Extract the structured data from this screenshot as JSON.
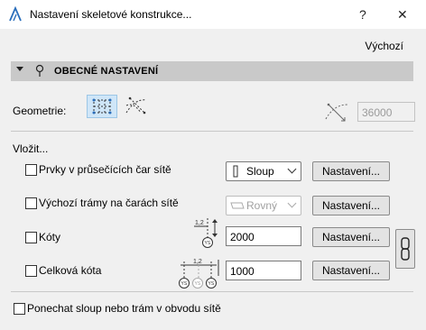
{
  "titlebar": {
    "title": "Nastavení skeletové konstrukce...",
    "help_label": "?",
    "close_label": "✕"
  },
  "defaults_link": "Výchozí",
  "section": {
    "title": "OBECNÉ NASTAVENÍ"
  },
  "geometry": {
    "label": "Geometrie:",
    "value": "36000"
  },
  "insert": {
    "label": "Vložit...",
    "rows": [
      {
        "label": "Prvky v průsečících čar sítě",
        "select": "Sloup",
        "button": "Nastavení..."
      },
      {
        "label": "Výchozí trámy na čarách sítě",
        "select": "Rovný",
        "button": "Nastavení..."
      },
      {
        "label": "Kóty",
        "input": "2000",
        "button": "Nastavení...",
        "icon_num": "1,2",
        "circle": "YS"
      },
      {
        "label": "Celková kóta",
        "input": "1000",
        "button": "Nastavení...",
        "icon_num": "1,2",
        "circles": [
          "YS",
          "YS",
          "YS"
        ]
      }
    ]
  },
  "keep_label": "Ponechat sloup nebo trám v obvodu sítě",
  "colors": {
    "section_bg": "#c9c9c9",
    "selected_bg": "#cfe6f8"
  }
}
